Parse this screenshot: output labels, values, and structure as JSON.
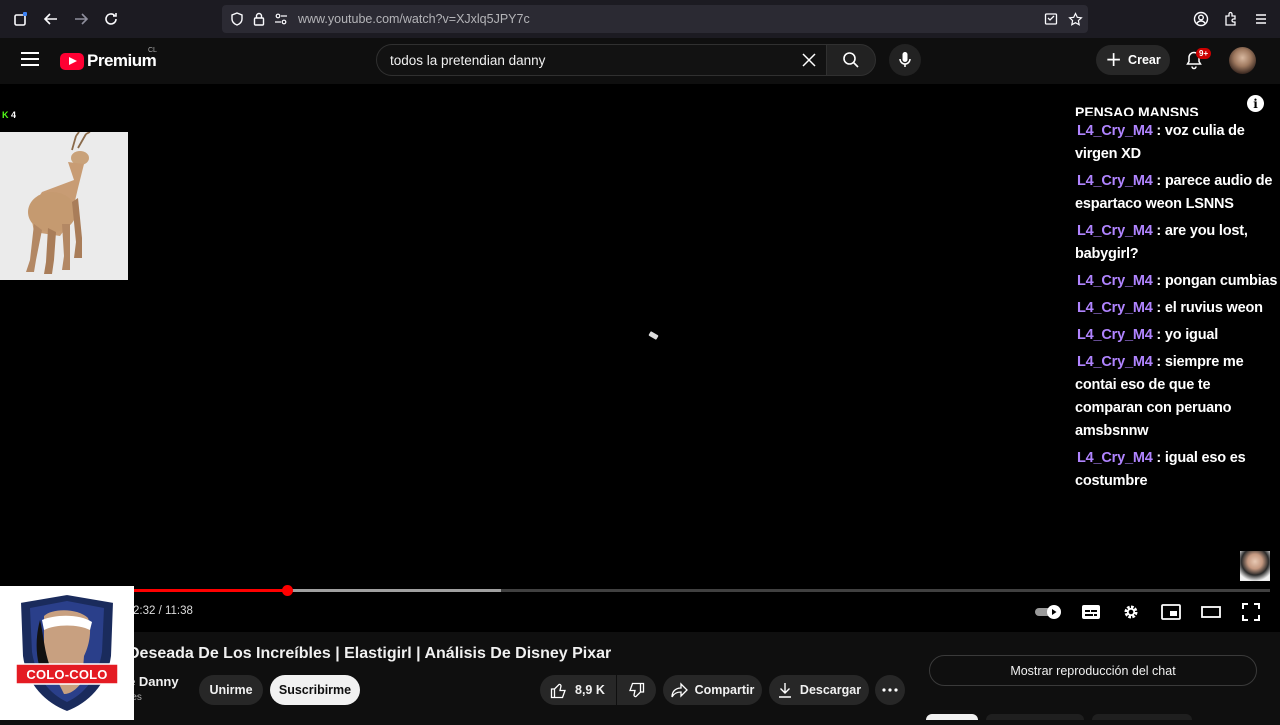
{
  "browser": {
    "url": "www.youtube.com/watch?v=XJxlq5JPY7c"
  },
  "header": {
    "logo_text": "Premium",
    "region": "CL",
    "search_value": "todos la pretendian danny",
    "create_label": "Crear",
    "notifications_badge": "9+"
  },
  "overlay": {
    "kick_count": "4"
  },
  "chat": {
    "top_partial": "PENSAO MANSNS",
    "messages": [
      {
        "user": "L4_Cry_M4",
        "text": " : voz culia de virgen XD"
      },
      {
        "user": "L4_Cry_M4",
        "text": " : parece audio de espartaco weon LSNNS"
      },
      {
        "user": "L4_Cry_M4",
        "text": " : are you lost, babygirl?"
      },
      {
        "user": "L4_Cry_M4",
        "text": " : pongan cumbias"
      },
      {
        "user": "L4_Cry_M4",
        "text": " : el ruvius weon"
      },
      {
        "user": "L4_Cry_M4",
        "text": " : yo igual"
      },
      {
        "user": "L4_Cry_M4",
        "text": " : siempre me contai eso de que te comparan con peruano amsbsnnw"
      },
      {
        "user": "L4_Cry_M4",
        "text": " : igual eso es costumbre"
      }
    ]
  },
  "player": {
    "time_display": "2:32 / 11:38",
    "played_fraction": 0.138,
    "loaded_fraction": 0.325
  },
  "video": {
    "title": "Deseada De Los Increíbles | Elastigirl | Análisis De Disney Pixar",
    "channel": "e Danny",
    "subs_partial": "res",
    "join_label": "Unirme",
    "subscribe_label": "Suscribirme",
    "likes": "8,9 K",
    "share_label": "Compartir",
    "download_label": "Descargar",
    "chat_replay_label": "Mostrar reproducción del chat"
  },
  "logo_overlay": {
    "text": "COLO-COLO"
  },
  "colors": {
    "progress": "#ff0000",
    "chat_user": "#b084ff",
    "kick_green": "#53fc18"
  }
}
